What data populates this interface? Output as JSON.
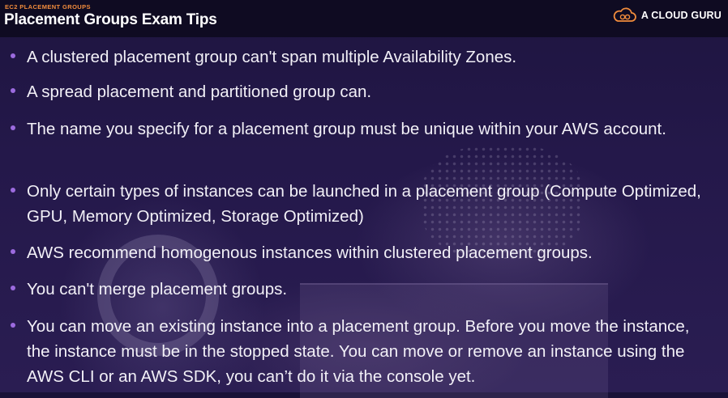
{
  "header": {
    "kicker": "EC2 PLACEMENT GROUPS",
    "title": "Placement Groups Exam Tips",
    "brand_text": "A CLOUD GURU",
    "brand_icon": "cloud-icon",
    "accent_color": "#f28c3c"
  },
  "tips": [
    "A clustered placement group can't span multiple Availability Zones.",
    "A spread placement and partitioned group can.",
    "The name you specify for a placement group must be unique within your AWS account.",
    "Only certain types of instances can be launched in a placement group (Compute Optimized, GPU, Memory Optimized, Storage Optimized)",
    "AWS recommend homogenous instances within clustered placement groups.",
    "You can't merge placement groups.",
    "You can move an existing instance into a placement group. Before you move the instance, the instance must be in the stopped state. You can move or remove an instance using the AWS CLI or an AWS SDK, you can’t do it via the console yet."
  ],
  "colors": {
    "bullet": "#9c6bdf",
    "text": "#f2f0f7",
    "header_bg": "#0f0b22"
  }
}
